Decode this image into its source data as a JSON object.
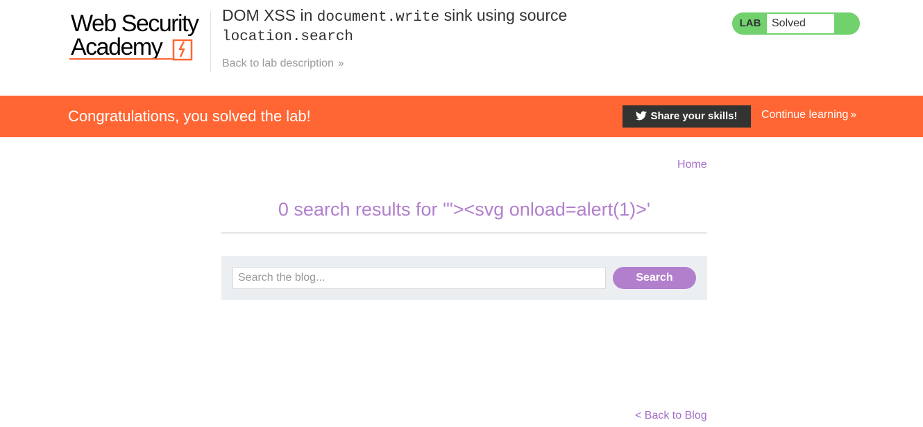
{
  "logo": {
    "line1": "Web Security",
    "line2": "Academy",
    "brand_color": "#ff6633"
  },
  "lab": {
    "title_pre": "DOM XSS in ",
    "title_code1": "document.write",
    "title_mid": " sink using source",
    "title_code2": "location.search",
    "back_link": "Back to lab description",
    "badge_label": "LAB",
    "badge_status": "Solved",
    "badge_color": "#70d16d"
  },
  "banner": {
    "message": "Congratulations, you solved the lab!",
    "share_label": "Share your skills!",
    "continue_label": "Continue learning",
    "color": "#ff6633"
  },
  "nav": {
    "home": "Home"
  },
  "results": {
    "heading": "0 search results for '\"><svg onload=alert(1)>'"
  },
  "search": {
    "placeholder": "Search the blog...",
    "value": "",
    "button_label": "Search"
  },
  "footer": {
    "back_to_blog": "< Back to Blog"
  },
  "icons": {
    "logo_mark": "lightning-bolt-icon",
    "twitter": "twitter-icon",
    "chevron": "double-chevron-right-icon"
  }
}
